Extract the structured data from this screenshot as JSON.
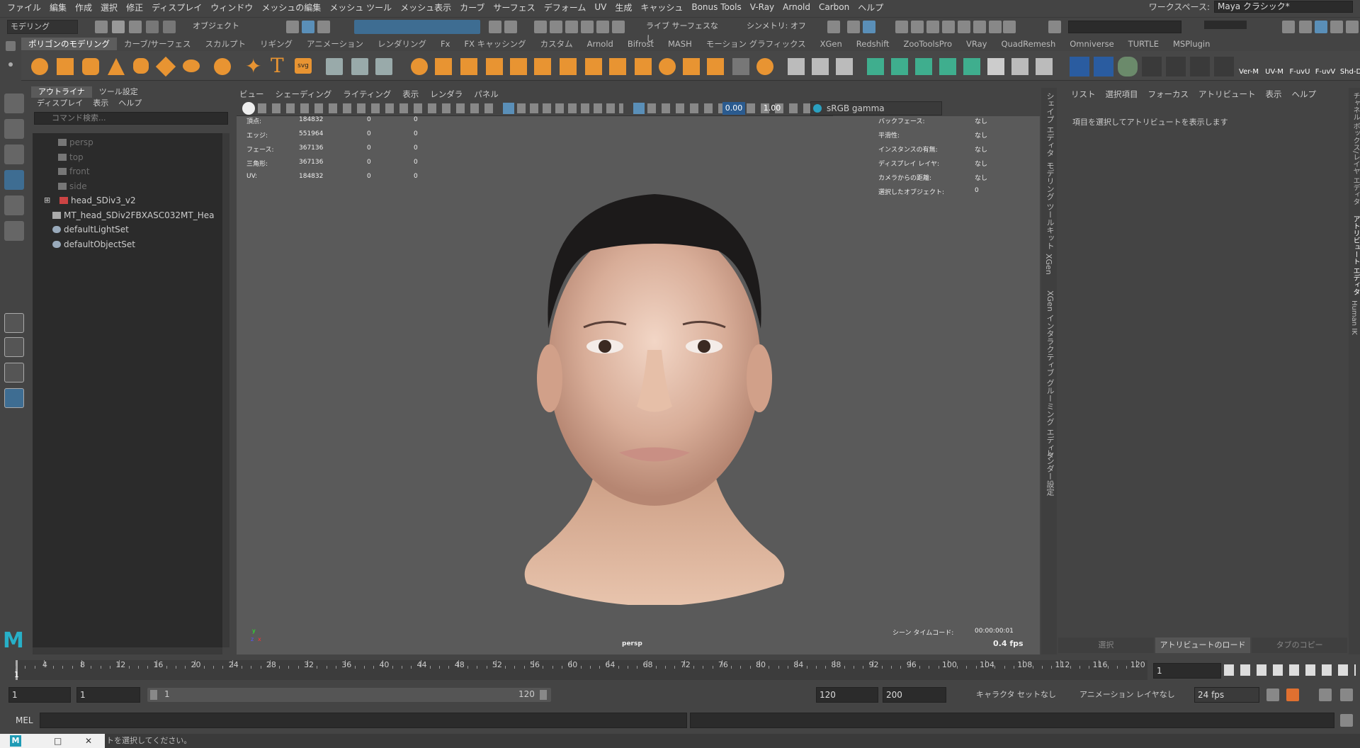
{
  "menubar": {
    "items": [
      "ファイル",
      "編集",
      "作成",
      "選択",
      "修正",
      "ディスプレイ",
      "ウィンドウ",
      "メッシュの編集",
      "メッシュ ツール",
      "メッシュ表示",
      "カーブ",
      "サーフェス",
      "デフォーム",
      "UV",
      "生成",
      "キャッシュ",
      "Bonus Tools",
      "V-Ray",
      "Arnold",
      "Carbon",
      "ヘルプ"
    ],
    "workspace_label": "ワークスペース:",
    "workspace_value": "Maya クラシック*"
  },
  "statusline": {
    "mode": "モデリング",
    "object_mode": "オブジェクト",
    "live_surface": "ライブ サーフェスなし",
    "symmetry": "シンメトリ: オフ"
  },
  "shelf": {
    "tabs": [
      "ポリゴンのモデリング",
      "カーブ/サーフェス",
      "スカルプト",
      "リギング",
      "アニメーション",
      "レンダリング",
      "Fx",
      "FX キャッシング",
      "カスタム",
      "Arnold",
      "Bifrost",
      "MASH",
      "モーション グラフィックス",
      "XGen",
      "Redshift",
      "ZooToolsPro",
      "VRay",
      "QuadRemesh",
      "Omniverse",
      "TURTLE",
      "MSPlugin"
    ],
    "active_tab": "ポリゴンのモデリング",
    "labels": [
      "Ver-M",
      "UV-M",
      "F-uvU",
      "F-uvV",
      "Shd-D"
    ]
  },
  "outliner": {
    "tabs": [
      "アウトライナ",
      "ツール設定"
    ],
    "menu": [
      "ディスプレイ",
      "表示",
      "ヘルプ"
    ],
    "search_placeholder": "コマンド検索...",
    "items": [
      {
        "name": "persp",
        "type": "camera",
        "dim": true
      },
      {
        "name": "top",
        "type": "camera",
        "dim": true
      },
      {
        "name": "front",
        "type": "camera",
        "dim": true
      },
      {
        "name": "side",
        "type": "camera",
        "dim": true
      },
      {
        "name": "head_SDiv3_v2",
        "type": "mesh",
        "dim": false
      },
      {
        "name": "MT_head_SDiv2FBXASC032MT_Hea",
        "type": "material",
        "dim": false
      },
      {
        "name": "defaultLightSet",
        "type": "set",
        "dim": false
      },
      {
        "name": "defaultObjectSet",
        "type": "set",
        "dim": false
      }
    ]
  },
  "viewport": {
    "menu": [
      "ビュー",
      "シェーディング",
      "ライティング",
      "表示",
      "レンダラ",
      "パネル"
    ],
    "exposure": "0.00",
    "gamma": "1.00",
    "color_space": "sRGB gamma",
    "camera_name": "persp",
    "timecode_label": "シーン タイムコード:",
    "timecode_value": "00:00:00:01",
    "fps_display": "0.4 fps",
    "stats_left": [
      {
        "label": "頂点:",
        "v1": "184832",
        "v2": "0",
        "v3": "0"
      },
      {
        "label": "エッジ:",
        "v1": "551964",
        "v2": "0",
        "v3": "0"
      },
      {
        "label": "フェース:",
        "v1": "367136",
        "v2": "0",
        "v3": "0"
      },
      {
        "label": "三角形:",
        "v1": "367136",
        "v2": "0",
        "v3": "0"
      },
      {
        "label": "UV:",
        "v1": "184832",
        "v2": "0",
        "v3": "0"
      }
    ],
    "stats_right": [
      {
        "label": "バックフェース:",
        "value": "なし"
      },
      {
        "label": "平滑性:",
        "value": "なし"
      },
      {
        "label": "インスタンスの有無:",
        "value": "なし"
      },
      {
        "label": "ディスプレイ レイヤ:",
        "value": "なし"
      },
      {
        "label": "カメラからの距離:",
        "value": "なし"
      },
      {
        "label": "選択したオブジェクト:",
        "value": "0"
      }
    ]
  },
  "side_tabs": [
    "シェイプ エディタ",
    "モデリング ツールキット",
    "XGen",
    "XGen インタラクティブ グルーミング エディタ",
    "レンダー設定"
  ],
  "far_side_tabs": [
    "チャネル ボックス/レイヤ エディタ",
    "アトリビュート エディタ",
    "Human IK"
  ],
  "attribute_editor": {
    "menu": [
      "リスト",
      "選択項目",
      "フォーカス",
      "アトリビュート",
      "表示",
      "ヘルプ"
    ],
    "message": "項目を選択してアトリビュートを表示します",
    "buttons": [
      "選択",
      "アトリビュートのロード",
      "タブのコピー"
    ]
  },
  "timeline": {
    "ticks": [
      "4",
      "8",
      "12",
      "16",
      "20",
      "24",
      "28",
      "32",
      "36",
      "40",
      "44",
      "48",
      "52",
      "56",
      "60",
      "64",
      "68",
      "72",
      "76",
      "80",
      "84",
      "88",
      "92",
      "96",
      "100",
      "104",
      "108",
      "112",
      "116",
      "120"
    ],
    "current_frame": "1",
    "current_field": "1"
  },
  "range": {
    "start": "1",
    "start2": "1",
    "slider_start": "1",
    "slider_end": "120",
    "end": "120",
    "end2": "200",
    "character_set": "キャラクタ セットなし",
    "anim_layer": "アニメーション レイヤなし",
    "fps": "24 fps"
  },
  "cmdline": {
    "label": "MEL"
  },
  "helpline": {
    "text": "トを選択してください。"
  }
}
